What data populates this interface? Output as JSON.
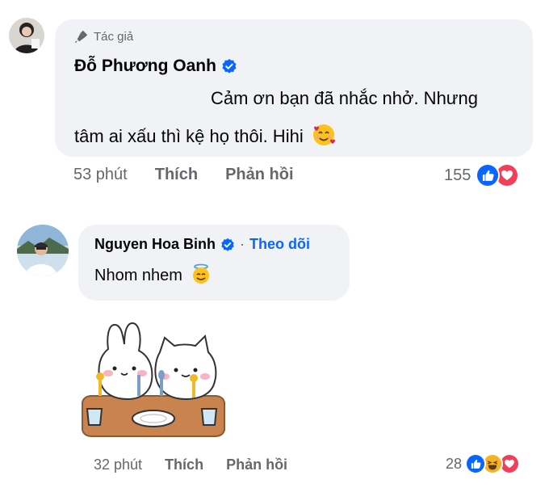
{
  "comment1": {
    "author_badge": "Tác giả",
    "author_name": "Đỗ Phương Oanh",
    "text_line1": "Cảm ơn bạn đã nhắc nhở. Nhưng",
    "text_line2": "tâm ai xấu thì kệ họ thôi. Hihi",
    "time": "53 phút",
    "like_label": "Thích",
    "reply_label": "Phản hồi",
    "reaction_count": "155",
    "reactions": [
      "like-icon",
      "love-icon"
    ]
  },
  "comment2": {
    "author_name": "Nguyen Hoa Binh",
    "separator": "·",
    "follow_label": "Theo dõi",
    "text": "Nhom nhem",
    "sticker": "bunny-and-cat-eating-sticker",
    "time": "32 phút",
    "like_label": "Thích",
    "reply_label": "Phản hồi",
    "reaction_count": "28",
    "reactions": [
      "like-icon",
      "haha-icon",
      "love-icon"
    ]
  },
  "colors": {
    "bubble": "#f0f2f5",
    "meta_text": "#65676b",
    "verified": "#0866ff",
    "like": "#0866ff",
    "love": "#f33e58",
    "haha": "#f7b125"
  }
}
